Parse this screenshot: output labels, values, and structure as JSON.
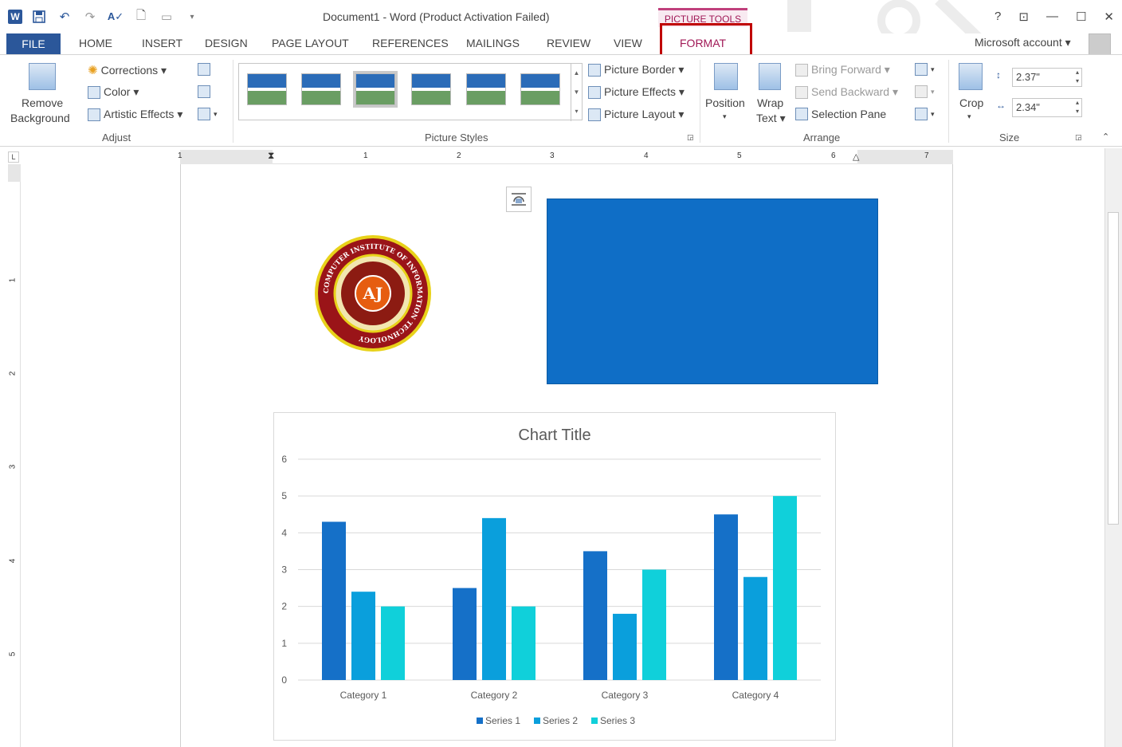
{
  "window": {
    "title": "Document1 - Word (Product Activation Failed)",
    "contextual_tab_group": "PICTURE TOOLS",
    "help": "?",
    "restore_ribbon": "⊡",
    "minimize": "—",
    "maximize": "☐",
    "close": "✕"
  },
  "quick_access": {
    "undo": "↶",
    "redo": "↷",
    "new": "🗋"
  },
  "tabs": [
    "FILE",
    "HOME",
    "INSERT",
    "DESIGN",
    "PAGE LAYOUT",
    "REFERENCES",
    "MAILINGS",
    "REVIEW",
    "VIEW",
    "FORMAT"
  ],
  "account": {
    "label": "Microsoft account",
    "dropdown": "▾"
  },
  "ribbon": {
    "adjust": {
      "group_label": "Adjust",
      "remove_bg_line1": "Remove",
      "remove_bg_line2": "Background",
      "corrections": "Corrections ▾",
      "color": "Color ▾",
      "artistic": "Artistic Effects ▾"
    },
    "picture_styles": {
      "group_label": "Picture Styles",
      "border": "Picture Border ▾",
      "effects": "Picture Effects ▾",
      "layout": "Picture Layout ▾"
    },
    "arrange": {
      "group_label": "Arrange",
      "position": "Position",
      "wrap_line1": "Wrap",
      "wrap_line2": "Text ▾",
      "bring_forward": "Bring Forward ▾",
      "send_backward": "Send Backward ▾",
      "selection_pane": "Selection Pane"
    },
    "size": {
      "group_label": "Size",
      "crop": "Crop",
      "height": "2.37\"",
      "width": "2.34\""
    }
  },
  "ruler": {
    "corner": "L",
    "h_numbers": [
      "1",
      "1",
      "2",
      "3",
      "4",
      "5",
      "6",
      "7"
    ],
    "v_numbers": [
      "1",
      "2",
      "3",
      "4",
      "5"
    ]
  },
  "logo": {
    "initials": "AJ",
    "ring_text": "COMPUTER INSTITUTE OF INFORMATION TECHNOLOGY"
  },
  "colors": {
    "accent": "#2b579a",
    "format_tab": "#a01856",
    "highlight_box": "#c00000",
    "shape_fill": "#0f6ec6"
  },
  "chart_data": {
    "type": "bar",
    "title": "Chart Title",
    "categories": [
      "Category 1",
      "Category 2",
      "Category 3",
      "Category 4"
    ],
    "series": [
      {
        "name": "Series 1",
        "values": [
          4.3,
          2.5,
          3.5,
          4.5
        ],
        "color": "#1570c8"
      },
      {
        "name": "Series 2",
        "values": [
          2.4,
          4.4,
          1.8,
          2.8
        ],
        "color": "#0a9fdc"
      },
      {
        "name": "Series 3",
        "values": [
          2,
          2,
          3,
          5
        ],
        "color": "#10d0da"
      }
    ],
    "ylim": [
      0,
      6
    ],
    "yticks": [
      "0",
      "1",
      "2",
      "3",
      "4",
      "5",
      "6"
    ],
    "grid": true,
    "legend": "bottom"
  }
}
